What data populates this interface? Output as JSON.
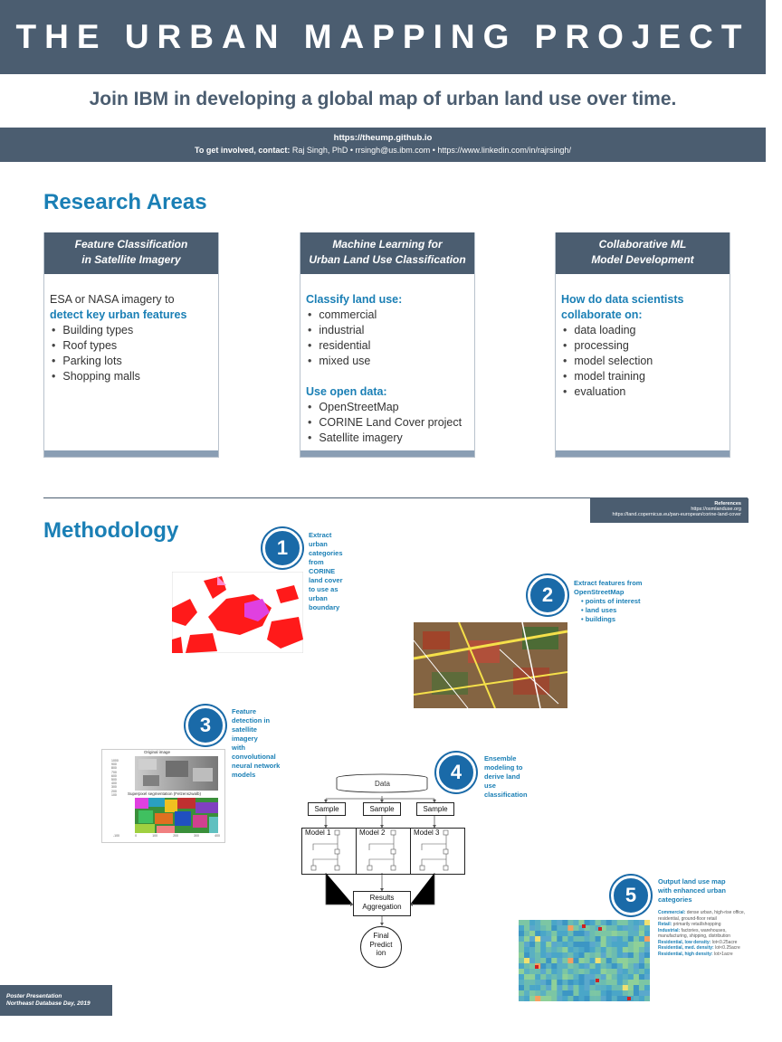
{
  "header": {
    "title": "THE URBAN MAPPING PROJECT",
    "subtitle": "Join IBM in developing a global map of urban land use over time.",
    "url": "https://theump.github.io",
    "contact_label": "To get involved, contact:",
    "contact_details": "Raj Singh, PhD •  rrsingh@us.ibm.com • https://www.linkedin.com/in/rajrsingh/"
  },
  "research": {
    "heading": "Research Areas",
    "cards": [
      {
        "title_line1": "Feature Classification",
        "title_line2": "in Satellite Imagery",
        "intro": "ESA or NASA imagery to",
        "highlight": "detect key urban features",
        "items": [
          "Building types",
          "Roof types",
          "Parking lots",
          "Shopping malls"
        ]
      },
      {
        "title_line1": "Machine Learning  for",
        "title_line2": "Urban Land Use Classification",
        "group1_label": "Classify land use:",
        "group1_items": [
          "commercial",
          "industrial",
          "residential",
          "mixed use"
        ],
        "group2_label": "Use open data:",
        "group2_items": [
          "OpenStreetMap",
          "CORINE Land Cover project",
          "Satellite imagery"
        ]
      },
      {
        "title_line1": "Collaborative ML",
        "title_line2": "Model Development",
        "highlight_line1": "How do data scientists",
        "highlight_line2": "collaborate on:",
        "items": [
          "data loading",
          "processing",
          "model selection",
          "model training",
          "evaluation"
        ]
      }
    ]
  },
  "references": {
    "title": "References",
    "line1": "https://osmlanduse.org",
    "line2": "https://land.copernicus.eu/pan-european/corine-land-cover"
  },
  "methodology": {
    "heading": "Methodology",
    "steps": [
      {
        "number": "1",
        "caption": [
          "Extract",
          "urban",
          "categories",
          "from",
          "CORINE",
          "land cover",
          "to use as",
          "urban",
          "boundary"
        ]
      },
      {
        "number": "2",
        "caption": [
          "Extract features from",
          "OpenStreetMap"
        ],
        "bullets": [
          "points of interest",
          "land uses",
          "buildings"
        ]
      },
      {
        "number": "3",
        "caption": [
          "Feature",
          "detection in",
          "satellite",
          "imagery",
          "with",
          "convolutional",
          "neural network",
          "models"
        ]
      },
      {
        "number": "4",
        "caption": [
          "Ensemble",
          "modeling to",
          "derive land",
          "use",
          "classification"
        ]
      },
      {
        "number": "5",
        "caption": [
          "Output land use map",
          "with enhanced urban",
          "categories"
        ]
      }
    ],
    "plot_titles": {
      "top": "Original image",
      "bottom": "Superpixel segmentation (Felzenszwalb)"
    },
    "plot_yticks": [
      "1000",
      "900",
      "800",
      "700",
      "600",
      "500",
      "400",
      "300",
      "200",
      "100"
    ],
    "plot_xticks": [
      "-100",
      "0",
      "100",
      "200",
      "300",
      "400"
    ],
    "flow": {
      "data": "Data",
      "samples": [
        "Sample",
        "Sample",
        "Sample"
      ],
      "models": [
        "Model 1",
        "Model 2",
        "Model 3"
      ],
      "aggregation": [
        "Results",
        "Aggregation"
      ],
      "final": [
        "Final",
        "Predict",
        "ion"
      ]
    },
    "legend": [
      {
        "label": "Commercial:",
        "text": "dense urban, high-rise office, residential, ground-floor retail"
      },
      {
        "label": "Retail:",
        "text": "primarily retail/shopping"
      },
      {
        "label": "Industrial:",
        "text": "factories, warehouses, manufacturing, shipping, distribution"
      },
      {
        "label": "Residential, low density:",
        "text": "lot<0.25acre"
      },
      {
        "label": "Residential, med. density:",
        "text": "lot<0.25acre"
      },
      {
        "label": "Residential, high density:",
        "text": "lot>1acre"
      }
    ]
  },
  "footer": {
    "line1": "Poster Presentation",
    "line2": "Northeast Database Day, 2019"
  },
  "colors": {
    "band": "#4b5d70",
    "accent": "#1a7fb5",
    "step_circle": "#1a6aa8"
  }
}
